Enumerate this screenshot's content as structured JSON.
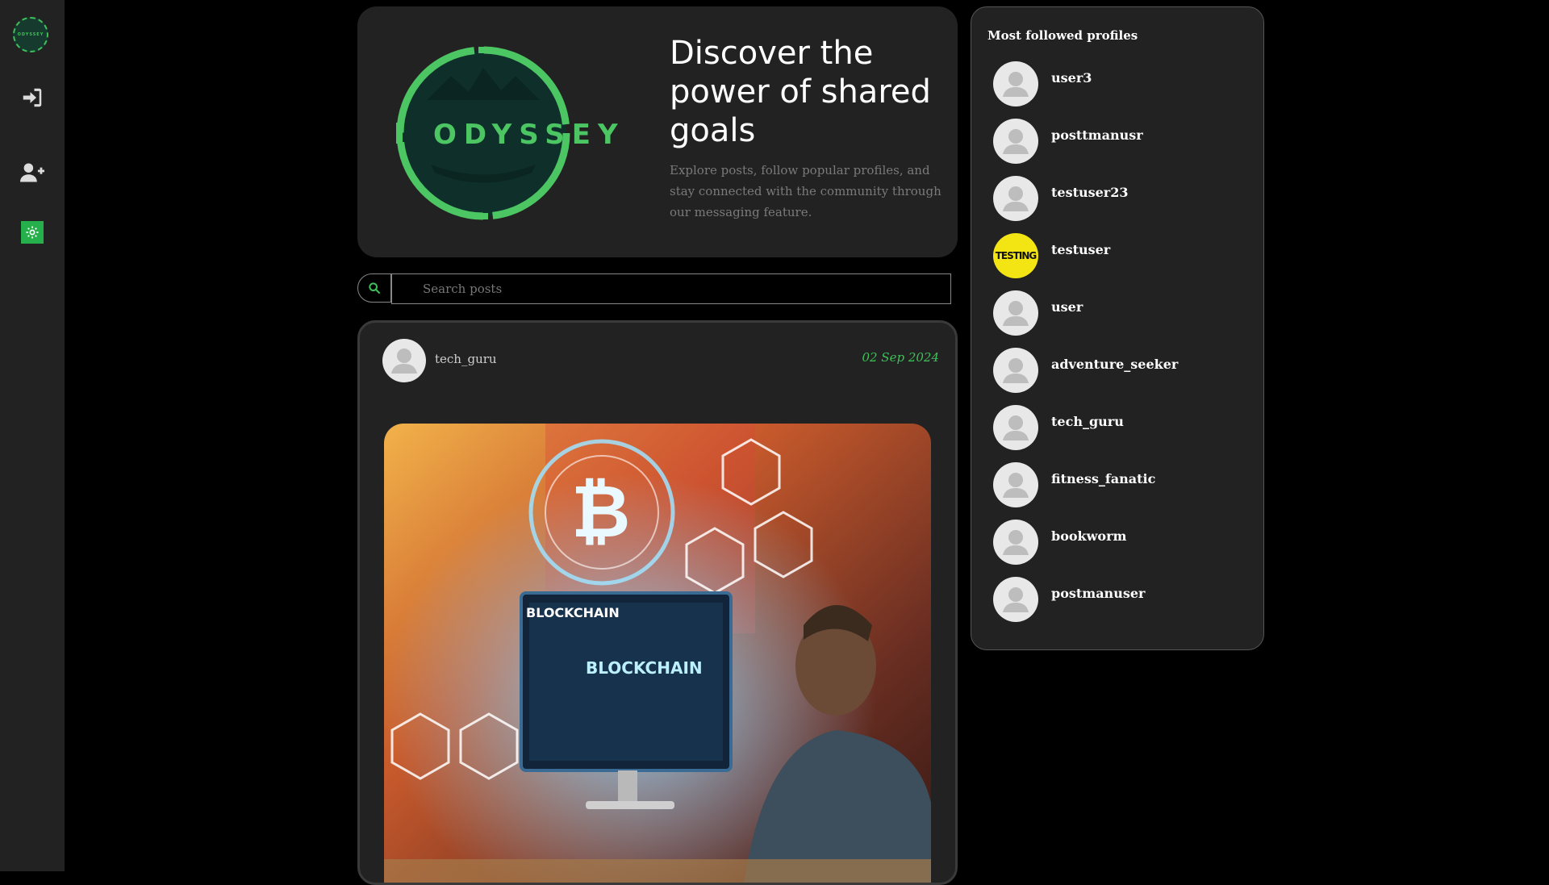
{
  "sidebar": {
    "logo_text": "ODYSSEY",
    "items": [
      {
        "name": "login",
        "icon": "login-icon"
      },
      {
        "name": "register",
        "icon": "add-user-icon"
      },
      {
        "name": "settings",
        "icon": "gear-icon"
      }
    ]
  },
  "hero": {
    "logo_text": "ODYSSEY",
    "title": "Discover the power of shared goals",
    "description": "Explore posts, follow popular profiles, and stay connected with the community through our messaging feature."
  },
  "search": {
    "placeholder": "Search posts",
    "icon": "search-icon"
  },
  "post": {
    "username": "tech_guru",
    "date": "02 Sep 2024",
    "image_labels": [
      "BLOCKCHAIN",
      "BLOCKCHAIN"
    ]
  },
  "profiles": {
    "title": "Most followed profiles",
    "items": [
      {
        "name": "user3"
      },
      {
        "name": "posttmanusr"
      },
      {
        "name": "testuser23"
      },
      {
        "name": "testuser",
        "avatar_text": "TESTING"
      },
      {
        "name": "user"
      },
      {
        "name": "adventure_seeker"
      },
      {
        "name": "tech_guru"
      },
      {
        "name": "fitness_fanatic"
      },
      {
        "name": "bookworm"
      },
      {
        "name": "postmanuser"
      }
    ]
  },
  "colors": {
    "accent": "#3fbf5a",
    "card_bg": "#222222",
    "page_bg": "#000000"
  }
}
